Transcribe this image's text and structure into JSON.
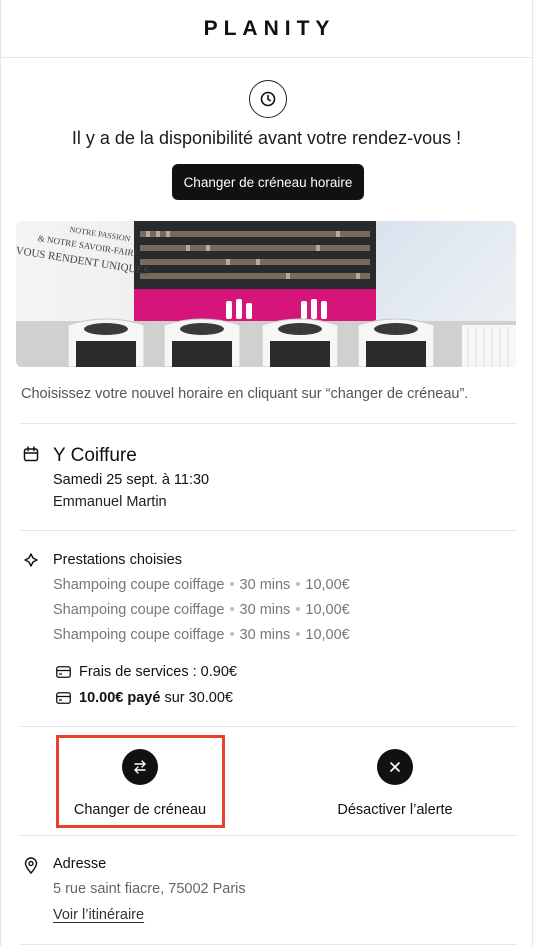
{
  "header": {
    "brand": "PLANITY"
  },
  "alert": {
    "icon": "clock-icon",
    "headline": "Il y a de la disponibilité avant votre rendez-vous !",
    "cta_label": "Changer de créneau horaire"
  },
  "salon_image": {
    "wall_text": [
      "NOTRE PASSION",
      "& NOTRE SAVOIR-FAIRE",
      "VOUS RENDENT UNIQUES"
    ],
    "accent_color": "#d6157a"
  },
  "hint": "Choisissez votre nouvel horaire en cliquant sur “changer de créneau”.",
  "appointment": {
    "icon": "calendar-icon",
    "salon_name": "Y Coiffure",
    "date": "Samedi 25 sept. à 11:30",
    "staff": "Emmanuel Martin"
  },
  "services": {
    "icon": "sparkle-icon",
    "title": "Prestations choisies",
    "items": [
      {
        "name": "Shampoing coupe coiffage",
        "duration": "30 mins",
        "price": "10,00€"
      },
      {
        "name": "Shampoing coupe coiffage",
        "duration": "30 mins",
        "price": "10,00€"
      },
      {
        "name": "Shampoing coupe coiffage",
        "duration": "30 mins",
        "price": "10,00€"
      }
    ],
    "fees_label": "Frais de services : 0.90€",
    "paid_amount": "10.00€ payé",
    "paid_total": "sur 30.00€"
  },
  "actions": {
    "change": {
      "icon": "swap-arrows-icon",
      "label": "Changer de créneau"
    },
    "disable": {
      "icon": "close-icon",
      "label": "Désactiver l’alerte"
    },
    "highlight_color": "#e5432e"
  },
  "address": {
    "icon": "map-pin-icon",
    "title": "Adresse",
    "line": "5 rue saint fiacre, 75002 Paris",
    "link": "Voir l’itinéraire"
  }
}
